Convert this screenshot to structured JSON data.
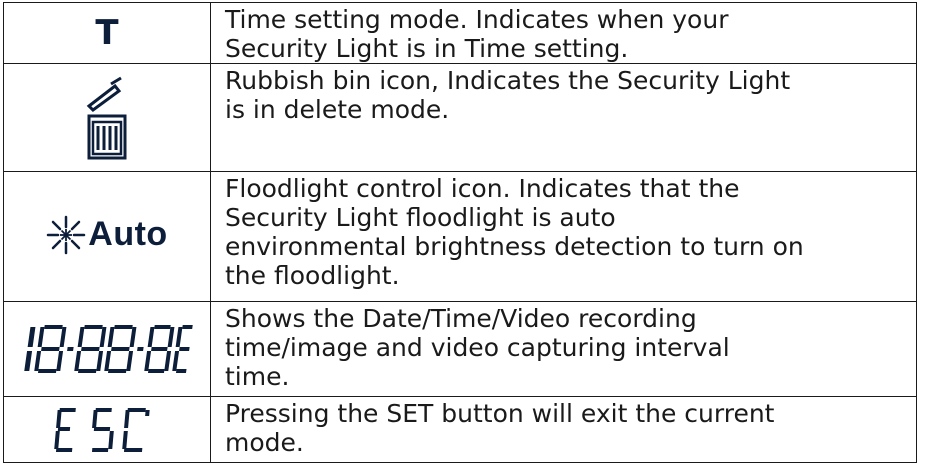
{
  "rows": [
    {
      "icon": "time-setting-t-icon",
      "icon_text": "T",
      "description": "Time setting mode. Indicates when your\nSecurity Light is in Time setting."
    },
    {
      "icon": "rubbish-bin-icon",
      "description": "Rubbish bin icon, Indicates the Security Light\nis in delete mode."
    },
    {
      "icon": "floodlight-auto-icon",
      "icon_text": "Auto",
      "description": "Floodlight control icon. Indicates that the\nSecurity Light floodlight is auto\nenvironmental brightness detection to turn on\nthe floodlight."
    },
    {
      "icon": "seven-segment-display-icon",
      "icon_text": "18:88:88",
      "description": "Shows the Date/Time/Video recording\n time/image and video capturing interval\n time."
    },
    {
      "icon": "esc-segment-icon",
      "icon_text": "ESC",
      "description": "Pressing the SET button will exit the current\nmode."
    }
  ],
  "colors": {
    "icon_color": "#0c1e3a",
    "text_color": "#1a1a1a",
    "border_color": "#1a1a1a"
  }
}
